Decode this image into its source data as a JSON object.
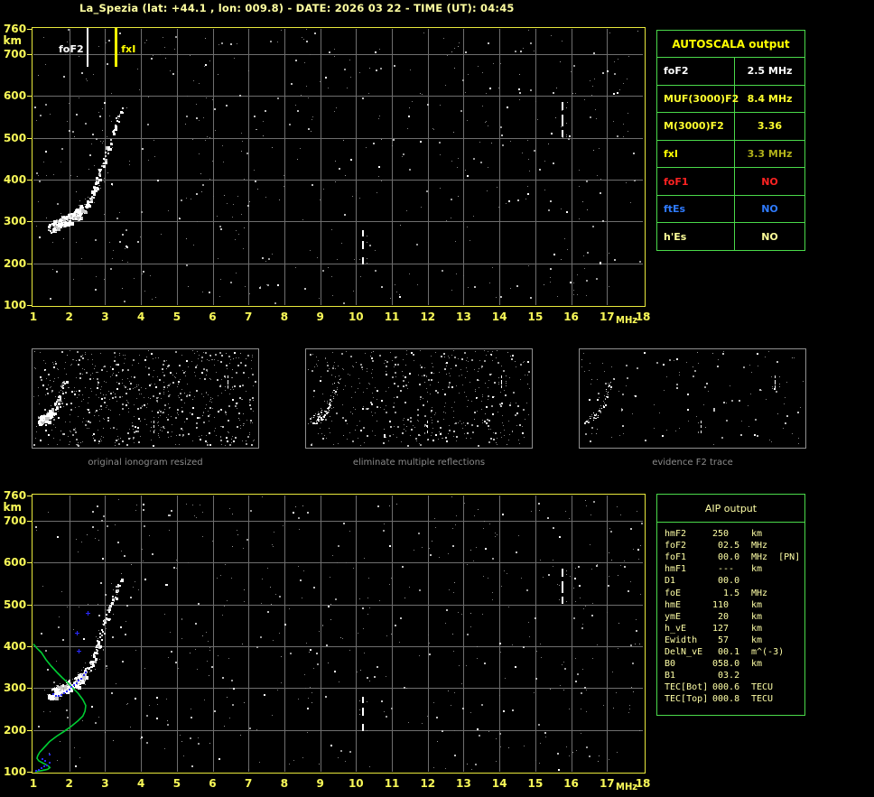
{
  "title": "La_Spezia (lat: +44.1 , lon: 009.8) - DATE: 2026 03 22 - TIME (UT): 04:45",
  "colors": {
    "background": "#000000",
    "title": "#ffffa0",
    "axis_labels": "#f8f858",
    "chart_border": "#e8e83c",
    "grid": "#6e6e6e",
    "trace_white": "#ffffff",
    "noise_gray": "#8a8a8a",
    "profile_green": "#00cc33",
    "fitted_blue": "#2a2aff",
    "table_border": "#4ad94a",
    "caption_gray": "#8c8c8c",
    "marker_fof2": "#ffffff",
    "marker_fxi": "#ffff00"
  },
  "autoscala_table": {
    "header": "AUTOSCALA output",
    "rows": [
      {
        "label": "foF2",
        "value": "2.5 MHz",
        "color": "#ffffff",
        "value_color": "#ffffff"
      },
      {
        "label": "MUF(3000)F2",
        "value": "8.4 MHz",
        "color": "#ffff2e",
        "value_color": "#ffff2e"
      },
      {
        "label": "M(3000)F2",
        "value": "3.36",
        "color": "#ffff2e",
        "value_color": "#ffff2e"
      },
      {
        "label": "fxI",
        "value": "3.3 MHz",
        "color": "#ffff00",
        "value_color": "#b2b21a"
      },
      {
        "label": "foF1",
        "value": "NO",
        "color": "#ff2222",
        "value_color": "#ff2222"
      },
      {
        "label": "ftEs",
        "value": "NO",
        "color": "#2f7bff",
        "value_color": "#2f7bff"
      },
      {
        "label": "h'Es",
        "value": "NO",
        "color": "#ffff99",
        "value_color": "#ffff99"
      }
    ]
  },
  "aip_table": {
    "header": "AIP output",
    "rows": [
      {
        "label": "hmF2",
        "value": "250",
        "unit": "km"
      },
      {
        "label": "foF2",
        "value": " 02.5",
        "unit": "MHz"
      },
      {
        "label": "foF1",
        "value": " 00.0",
        "unit": "MHz  [PN]"
      },
      {
        "label": "hmF1",
        "value": " ---",
        "unit": "km"
      },
      {
        "label": "D1",
        "value": " 00.0",
        "unit": ""
      },
      {
        "label": "foE",
        "value": "  1.5",
        "unit": "MHz"
      },
      {
        "label": "hmE",
        "value": "110",
        "unit": "km"
      },
      {
        "label": "ymE",
        "value": " 20",
        "unit": "km"
      },
      {
        "label": "h_vE",
        "value": "127",
        "unit": "km"
      },
      {
        "label": "Ewidth",
        "value": " 57",
        "unit": "km"
      },
      {
        "label": "DelN_vE",
        "value": " 00.1",
        "unit": "m^(-3)"
      },
      {
        "label": "B0",
        "value": "058.0",
        "unit": "km"
      },
      {
        "label": "B1",
        "value": " 03.2",
        "unit": ""
      },
      {
        "label": "TEC[Bot]",
        "value": "000.6",
        "unit": "TECU"
      },
      {
        "label": "TEC[Top]",
        "value": "000.8",
        "unit": "TECU"
      }
    ]
  },
  "panels": [
    {
      "caption": "original ionogram resized"
    },
    {
      "caption": "eliminate multiple reflections"
    },
    {
      "caption": "evidence F2 trace"
    }
  ],
  "chart_data": {
    "type": "scatter",
    "description": "vertical incidence ionograms: virtual height (km) vs frequency (MHz)",
    "x_axis": {
      "label": "MHz",
      "range": [
        1,
        18
      ],
      "ticks": [
        1,
        2,
        3,
        4,
        5,
        6,
        7,
        8,
        9,
        10,
        11,
        12,
        13,
        14,
        15,
        16,
        17,
        18
      ]
    },
    "y_axis": {
      "label": "km",
      "range": [
        100,
        760
      ],
      "ticks": [
        760,
        700,
        600,
        500,
        400,
        300,
        200,
        100
      ]
    },
    "grid": true,
    "scaled_markers": [
      {
        "name": "foF2",
        "mhz": 2.5,
        "color": "#ffffff"
      },
      {
        "name": "fxI",
        "mhz": 3.3,
        "color": "#ffff00"
      }
    ],
    "f2_trace_points_mhz_km": [
      [
        1.45,
        283
      ],
      [
        1.55,
        290
      ],
      [
        1.68,
        297
      ],
      [
        1.82,
        302
      ],
      [
        1.95,
        306
      ],
      [
        2.08,
        311
      ],
      [
        2.2,
        318
      ],
      [
        2.32,
        327
      ],
      [
        2.42,
        336
      ],
      [
        2.52,
        347
      ],
      [
        2.6,
        359
      ],
      [
        2.67,
        372
      ],
      [
        2.73,
        386
      ],
      [
        2.78,
        400
      ],
      [
        2.83,
        415
      ],
      [
        2.88,
        431
      ],
      [
        2.94,
        447
      ],
      [
        3.0,
        462
      ],
      [
        3.06,
        478
      ],
      [
        3.12,
        494
      ],
      [
        3.19,
        510
      ],
      [
        3.26,
        527
      ],
      [
        3.33,
        543
      ],
      [
        3.4,
        558
      ],
      [
        3.45,
        570
      ]
    ],
    "interference_lines": [
      {
        "mhz": 10.2,
        "segments_km": [
          [
            264,
            280
          ],
          [
            234,
            253
          ],
          [
            197,
            214
          ]
        ]
      },
      {
        "mhz": 15.75,
        "segments_km": [
          [
            565,
            585
          ],
          [
            527,
            555
          ],
          [
            501,
            518
          ]
        ]
      }
    ],
    "bottom_chart": {
      "profile_curve_mhz_km": [
        [
          1.0,
          405
        ],
        [
          1.1,
          395
        ],
        [
          1.22,
          385
        ],
        [
          1.35,
          368
        ],
        [
          1.5,
          352
        ],
        [
          1.65,
          338
        ],
        [
          1.8,
          325
        ],
        [
          1.95,
          313
        ],
        [
          2.1,
          300
        ],
        [
          2.25,
          287
        ],
        [
          2.38,
          272
        ],
        [
          2.46,
          258
        ],
        [
          2.44,
          245
        ],
        [
          2.38,
          233
        ],
        [
          2.25,
          222
        ],
        [
          2.05,
          208
        ],
        [
          1.85,
          196
        ],
        [
          1.65,
          185
        ],
        [
          1.45,
          172
        ],
        [
          1.3,
          158
        ],
        [
          1.18,
          147
        ],
        [
          1.12,
          138
        ],
        [
          1.1,
          132
        ],
        [
          1.15,
          126
        ],
        [
          1.28,
          120
        ],
        [
          1.4,
          115
        ],
        [
          1.46,
          110
        ],
        [
          1.4,
          106
        ],
        [
          1.25,
          103
        ],
        [
          1.05,
          100
        ]
      ],
      "fitted_trace_points_mhz_km": [
        [
          1.55,
          286
        ],
        [
          1.62,
          282
        ],
        [
          1.7,
          281
        ],
        [
          1.78,
          284
        ],
        [
          1.85,
          288
        ],
        [
          1.93,
          292
        ],
        [
          2.0,
          297
        ],
        [
          2.07,
          302
        ],
        [
          2.13,
          306
        ],
        [
          2.2,
          311
        ],
        [
          2.27,
          317
        ],
        [
          2.33,
          323
        ],
        [
          2.4,
          330
        ],
        [
          2.45,
          338
        ],
        [
          1.08,
          102
        ],
        [
          1.15,
          105
        ],
        [
          1.22,
          108
        ],
        [
          1.3,
          112
        ],
        [
          1.38,
          116
        ],
        [
          1.45,
          121
        ],
        [
          1.33,
          125
        ],
        [
          1.25,
          130
        ],
        [
          1.45,
          140
        ]
      ],
      "stray_fitted_points_mhz_km": [
        [
          2.5,
          480
        ],
        [
          2.25,
          390
        ],
        [
          2.2,
          433
        ]
      ]
    },
    "noise": {
      "top_count": 560,
      "bottom_count": 560,
      "panel_counts": [
        680,
        480,
        130
      ],
      "seed": 20260322
    }
  }
}
